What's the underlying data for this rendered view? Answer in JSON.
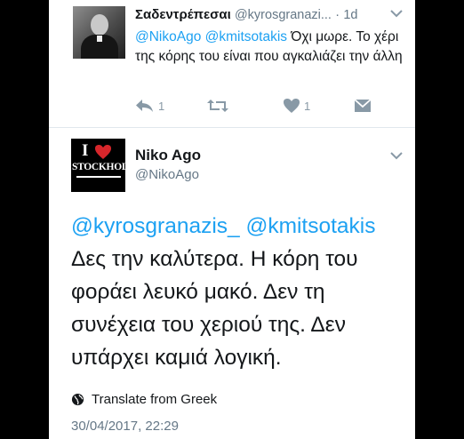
{
  "reply": {
    "name": "Σαδεντρέπεσαι",
    "handle": "@kyrosgranazi...",
    "separator": "·",
    "time": "1d",
    "avatar_icon": "user-photo",
    "chevron_icon": "chevron-down-icon",
    "text_mention_1": "@NikoAgo",
    "text_mention_2": "@kmitsotakis",
    "text_body": " Όχι μωρε. Το χέρι της κόρης του είναι που αγκαλιάζει την άλλη",
    "actions": {
      "reply_count": "1",
      "retweet_count": "",
      "like_count": "1",
      "icons": [
        "reply-icon",
        "retweet-icon",
        "like-icon",
        "dm-icon"
      ]
    }
  },
  "main": {
    "name": "Niko Ago",
    "handle": "@NikoAgo",
    "avatar": {
      "line1": "I",
      "line2": "STOCKHOLM"
    },
    "chevron_icon": "chevron-down-icon",
    "text_mention_1": "@kyrosgranazis_",
    "text_mention_2": "@kmitsotakis",
    "text_body": " Δες την καλύτερα. Η κόρη του φοράει λευκό μακό. Δεν τη συνέχεια του χεριού της. Δεν υπάρχει καμιά λογική.",
    "translate_label": "Translate from Greek",
    "translate_icon": "globe-icon",
    "timestamp": "30/04/2017, 22:29"
  },
  "colors": {
    "link": "#1da1f2",
    "text": "#14171a",
    "secondary": "#657786",
    "icon": "#8899a6",
    "frame": "#000000"
  }
}
